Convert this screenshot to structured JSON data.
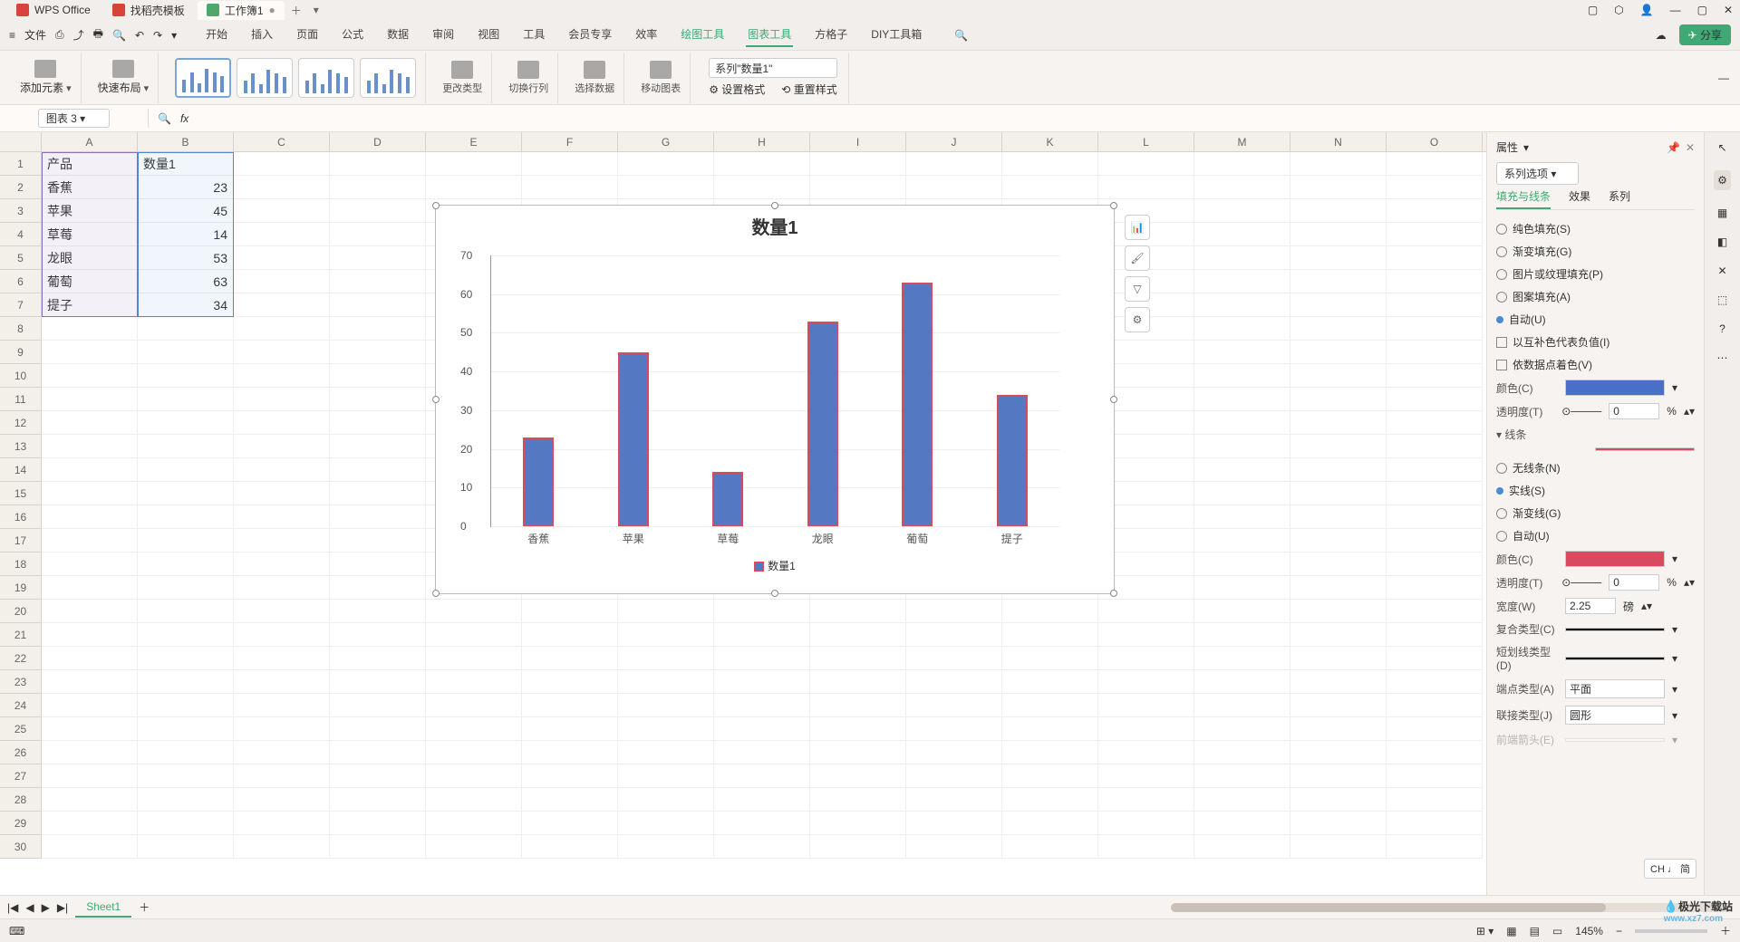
{
  "titlebar": {
    "app_name": "WPS Office",
    "tab2": "找稻壳模板",
    "tab3": "工作簿1"
  },
  "menubar": {
    "file": "文件",
    "items": [
      "开始",
      "插入",
      "页面",
      "公式",
      "数据",
      "审阅",
      "视图",
      "工具",
      "会员专享",
      "效率",
      "绘图工具",
      "图表工具",
      "方格子",
      "DIY工具箱"
    ],
    "share": "分享"
  },
  "ribbon": {
    "add_element": "添加元素",
    "quick_layout": "快速布局",
    "change_type": "更改类型",
    "switch_rowcol": "切换行列",
    "select_data": "选择数据",
    "move_chart": "移动图表",
    "series_label": "系列\"数量1\"",
    "set_format": "设置格式",
    "reset_style": "重置样式"
  },
  "namebox": {
    "value": "图表 3"
  },
  "panel": {
    "title": "属性",
    "series_options": "系列选项",
    "tab_fill": "填充与线条",
    "tab_effect": "效果",
    "tab_series": "系列",
    "fill_pattern": "纯色填充(S)",
    "fill_gradient": "渐变填充(G)",
    "fill_picture": "图片或纹理填充(P)",
    "fill_pattern2": "图案填充(A)",
    "fill_auto": "自动(U)",
    "invert_neg": "以互补色代表负值(I)",
    "vary_color": "依数据点着色(V)",
    "color_lbl": "颜色(C)",
    "opacity_lbl": "透明度(T)",
    "opacity_val": "0",
    "pct": "%",
    "line_hdr": "▾ 线条",
    "line_none": "无线条(N)",
    "line_solid": "实线(S)",
    "line_gradient": "渐变线(G)",
    "line_auto": "自动(U)",
    "line_opacity": "0",
    "width_lbl": "宽度(W)",
    "width_val": "2.25",
    "width_unit": "磅",
    "compound_lbl": "复合类型(C)",
    "dash_lbl": "短划线类型(D)",
    "cap_lbl": "端点类型(A)",
    "cap_val": "平面",
    "join_lbl": "联接类型(J)",
    "join_val": "圆形",
    "arrow_lbl": "前端箭头(E)"
  },
  "status": {
    "zoom": "145%"
  },
  "sheettab": "Sheet1",
  "watermark": "极光下载站",
  "watermark_url": "www.xz7.com",
  "ime": "CH ♩ 简",
  "chart_data": {
    "type": "bar",
    "title": "数量1",
    "legend": "数量1",
    "categories": [
      "香蕉",
      "苹果",
      "草莓",
      "龙眼",
      "葡萄",
      "提子"
    ],
    "values": [
      23,
      45,
      14,
      53,
      63,
      34
    ],
    "ylim": [
      0,
      70
    ],
    "yticks": [
      0,
      10,
      20,
      30,
      40,
      50,
      60,
      70
    ],
    "bar_fill": "#5578c2",
    "bar_outline": "#d94a5e"
  },
  "table": {
    "headers": [
      "产品",
      "数量1"
    ],
    "rows": [
      [
        "香蕉",
        "23"
      ],
      [
        "苹果",
        "45"
      ],
      [
        "草莓",
        "14"
      ],
      [
        "龙眼",
        "53"
      ],
      [
        "葡萄",
        "63"
      ],
      [
        "提子",
        "34"
      ]
    ]
  },
  "cols": [
    "A",
    "B",
    "C",
    "D",
    "E",
    "F",
    "G",
    "H",
    "I",
    "J",
    "K",
    "L",
    "M",
    "N",
    "O"
  ]
}
